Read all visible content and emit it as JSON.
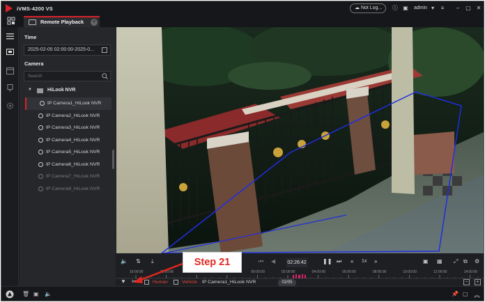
{
  "window": {
    "title": "iVMS-4200 VS",
    "status_pill": "Not Log...",
    "user": "admin"
  },
  "tabs": [
    {
      "label": "Remote Playback"
    }
  ],
  "left_panel": {
    "time_section": "Time",
    "time_range": "2025-02-05 02:00:00-2025-0...",
    "camera_section": "Camera",
    "search_placeholder": "Search",
    "nvr_name": "HiLook NVR",
    "cameras": [
      {
        "name": "IP Camera1_HiLook NVR",
        "state": "selected"
      },
      {
        "name": "IP Camera2_HiLook NVR",
        "state": "online"
      },
      {
        "name": "IP Camera3_HiLook NVR",
        "state": "online"
      },
      {
        "name": "IP Camera4_HiLook NVR",
        "state": "online"
      },
      {
        "name": "IP Camera5_HiLook NVR",
        "state": "online"
      },
      {
        "name": "IP Camera6_HiLook NVR",
        "state": "online"
      },
      {
        "name": "IP Camera7_HiLook NVR",
        "state": "offline"
      },
      {
        "name": "IP Camera8_HiLook NVR",
        "state": "offline"
      }
    ]
  },
  "playback": {
    "current_time": "02:26:42",
    "speed": "1x",
    "timeline_ticks": [
      "16:00:00",
      "18:00:00",
      "20:00:00",
      "22:00:00",
      "00:00:00",
      "02:00:00",
      "04:00:00",
      "06:00:00",
      "08:00:00",
      "10:00:00",
      "12:00:00",
      "14:00:00"
    ],
    "filters": {
      "human": "Human",
      "vehicle": "Vehicle",
      "camera": "IP Camera1_HiLook NVR"
    },
    "date_chip": "02/05"
  },
  "annotation": {
    "label": "Step 21"
  },
  "colors": {
    "accent": "#d8232a",
    "callout_text": "#e0271f",
    "detection_line": "#1f2ee0"
  }
}
